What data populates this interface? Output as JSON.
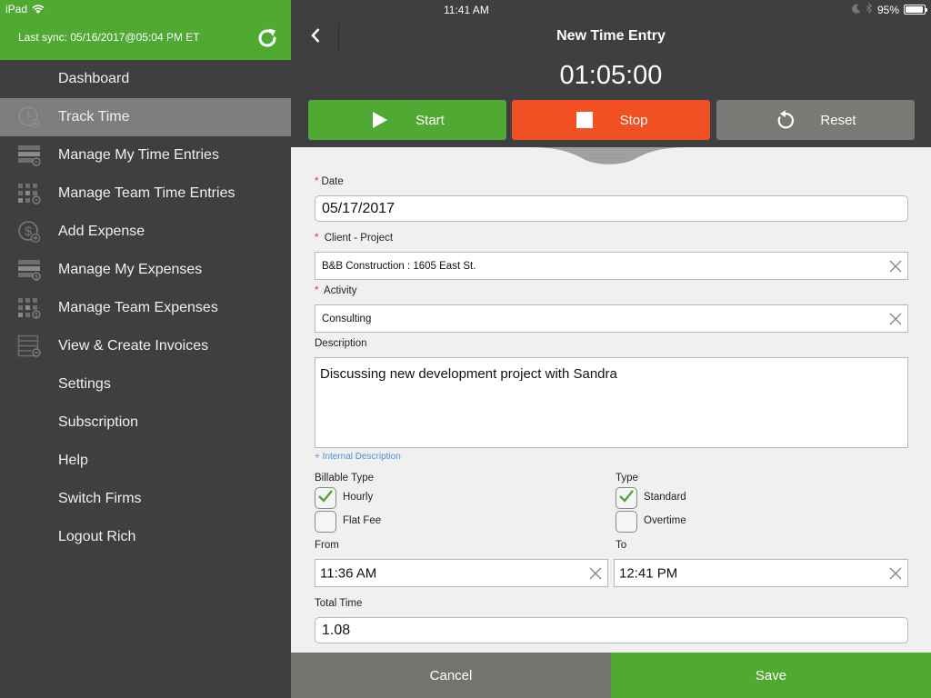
{
  "status_bar": {
    "device": "iPad",
    "time": "11:41 AM",
    "battery": "95%",
    "battery_level": 0.95
  },
  "sidebar": {
    "last_sync": "Last sync:  05/16/2017@05:04 PM ET",
    "refresh_icon": "refresh-icon",
    "items": [
      {
        "label": "Dashboard",
        "icon": "",
        "active": false
      },
      {
        "label": "Track Time",
        "icon": "clock-add-icon",
        "active": true
      },
      {
        "label": "Manage My Time Entries",
        "icon": "list-clock-icon",
        "active": false
      },
      {
        "label": "Manage Team Time Entries",
        "icon": "grid-clock-icon",
        "active": false
      },
      {
        "label": "Add Expense",
        "icon": "dollar-add-icon",
        "active": false
      },
      {
        "label": "Manage My Expenses",
        "icon": "list-dollar-icon",
        "active": false
      },
      {
        "label": "Manage Team Expenses",
        "icon": "grid-dollar-icon",
        "active": false
      },
      {
        "label": "View & Create Invoices",
        "icon": "invoice-icon",
        "active": false
      },
      {
        "label": "Settings",
        "icon": "",
        "active": false
      },
      {
        "label": "Subscription",
        "icon": "",
        "active": false
      },
      {
        "label": "Help",
        "icon": "",
        "active": false
      },
      {
        "label": "Switch Firms",
        "icon": "",
        "active": false
      },
      {
        "label": "Logout Rich",
        "icon": "",
        "active": false
      }
    ]
  },
  "header": {
    "title": "New Time Entry",
    "timer": "01:05:00",
    "start_label": "Start",
    "stop_label": "Stop",
    "reset_label": "Reset"
  },
  "form": {
    "date_label": "Date",
    "date_value": "05/17/2017",
    "client_label": "Client - Project",
    "client_value": "B&B Construction : 1605 East St.",
    "activity_label": "Activity",
    "activity_value": "Consulting",
    "description_label": "Description",
    "description_value": "Discussing new development project with Sandra",
    "internal_description_link": "+ Internal Description",
    "billable_type_label": "Billable Type",
    "billable_options": [
      {
        "label": "Hourly",
        "checked": true
      },
      {
        "label": "Flat Fee",
        "checked": false
      }
    ],
    "type_label": "Type",
    "type_options": [
      {
        "label": "Standard",
        "checked": true
      },
      {
        "label": "Overtime",
        "checked": false
      }
    ],
    "from_label": "From",
    "from_value": "11:36 AM",
    "to_label": "To",
    "to_value": "12:41 PM",
    "total_time_label": "Total Time",
    "total_time_value": "1.08"
  },
  "footer": {
    "cancel_label": "Cancel",
    "save_label": "Save"
  },
  "colors": {
    "accent_green": "#50a933",
    "stop_red": "#f25022",
    "reset_gray": "#7a7976",
    "sidebar_bg": "#3f3f41",
    "required_red": "#e0322d",
    "link_blue": "#4a90d9"
  }
}
